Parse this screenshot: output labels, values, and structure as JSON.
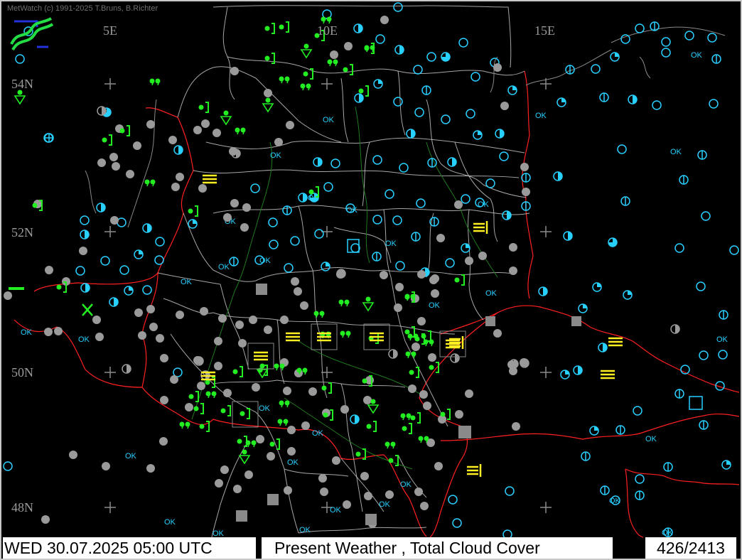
{
  "app": {
    "copyright": "MetWatch  (c) 1991-2025 T.Bruns, B.Richter"
  },
  "colors": {
    "background": "#000000",
    "borders": "#ff2020",
    "admin_lines": "#d0d0d0",
    "rivers": "#1f7a1f",
    "cloud_symbols": "#28d0ff",
    "grey_stations": "#9a9a9a",
    "precip_symbols": "#22ee22",
    "fog_symbols": "#ffee22"
  },
  "grid": {
    "lon_labels": [
      "5E",
      "10E",
      "15E"
    ],
    "lat_labels": [
      "54N",
      "52N",
      "50N",
      "48N"
    ]
  },
  "stations": {
    "ok_label": "OK"
  },
  "footer": {
    "datetime": "WED 30.07.2025 05:00 UTC",
    "title": "Present Weather    , Total Cloud Cover",
    "count": "426/2413"
  },
  "icons": {
    "logo": "metwatch-logo-icon",
    "cloud_cover": "cloud-cover-circle-icon",
    "drizzle": "drizzle-icon",
    "rain_shower": "rain-shower-icon",
    "fog": "fog-icon",
    "thunderstorm": "thunderstorm-icon"
  }
}
